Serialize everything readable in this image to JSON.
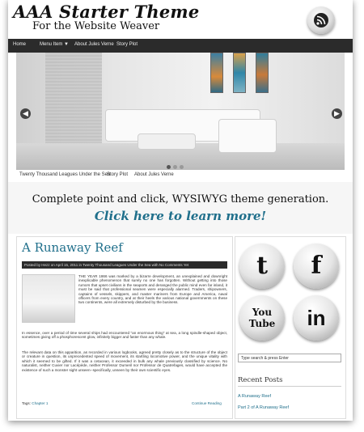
{
  "header": {
    "site_title": "AAA Starter Theme",
    "site_description": "For the Website Weaver",
    "rss_icon": "rss-icon"
  },
  "nav": {
    "items": [
      {
        "label": "Home"
      },
      {
        "label": "Menu Item ▼"
      },
      {
        "label": "About Jules Verne"
      },
      {
        "label": "Story Plot"
      }
    ]
  },
  "slider": {
    "prev_icon": "chevron-left-icon",
    "next_icon": "chevron-right-icon",
    "tabs": [
      {
        "label": "Twenty Thousand Leagues Under the Sea"
      },
      {
        "label": "Story Plot"
      },
      {
        "label": "About Jules Verne"
      }
    ]
  },
  "promo": {
    "line": "Complete point and click, WYSIWYG theme generation.",
    "link": "Click here to learn more!"
  },
  "post": {
    "title": "A Runaway Reef",
    "meta": "Posted by Hezz on April 15, 2011 in Twenty Thousand Leagues Under the Sea with No Comments Yet",
    "para1": "THE YEAR 1866 was marked by a bizarre development, an unexplained and downright inexplicable phenomenon that surely no one has forgotten. Without getting into those rumors that upset civilians in the seaports and deranged the public mind even far inland, it must be said that professional seamen were especially alarmed. Traders, shipowners, captains of vessels, skippers, and master mariners from Europe and America, naval officers from every country, and at their heels the various national governments on these two continents, were all extremely disturbed by the business.",
    "para2": "In essence, over a period of time several ships had encountered \"an enormous thing\" at sea, a long spindle-shaped object, sometimes giving off a phosphorescent glow, infinitely bigger and faster than any whale.",
    "para3": "The relevant data on this apparition, as recorded in various logbooks, agreed pretty closely as to the structure of the object or creature in question, its unprecedented speed of movement, its startling locomotive power, and the unique vitality with which it seemed to be gifted. If it was a cetacean, it exceeded in bulk any whale previously classified by science. No naturalist, neither Cuvier nor Lacépède, neither Professor Dumeril nor Professor de Quatrefages, would have accepted the existence of such a monster sight unseen--specifically, unseen by their own scientific eyes.",
    "tags_label": "Tags:",
    "tag": "Chapter 1",
    "read_more": "Continue Reading"
  },
  "sidebar": {
    "social": [
      {
        "label": "t",
        "icon": "twitter-icon"
      },
      {
        "label": "f",
        "icon": "facebook-icon"
      },
      {
        "label": "You Tube",
        "icon": "youtube-icon"
      },
      {
        "label": "in",
        "icon": "linkedin-icon"
      }
    ],
    "search_placeholder": "Type search & press Enter",
    "recent_title": "Recent Posts",
    "recent_items": [
      {
        "label": "A Runaway Reef"
      },
      {
        "label": "Part 2 of A Runaway Reef"
      }
    ]
  },
  "colors": {
    "accent": "#1f6f8b",
    "nav_bg": "#2b2b2b"
  }
}
